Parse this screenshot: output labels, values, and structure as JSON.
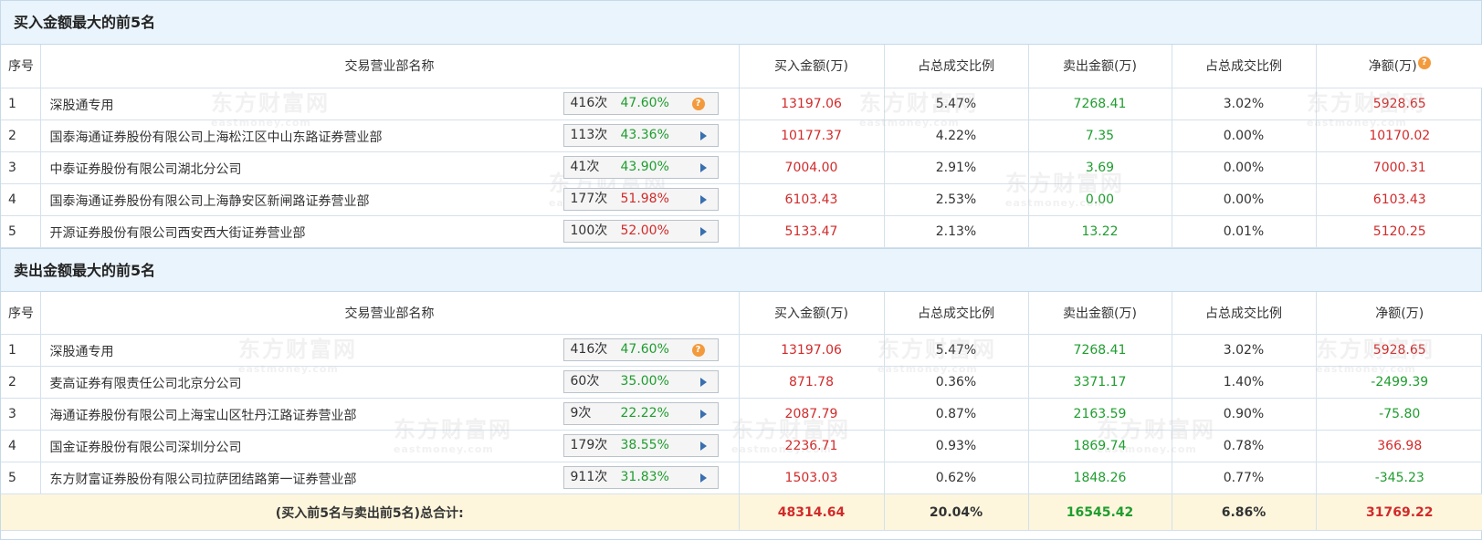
{
  "buy": {
    "title": "买入金额最大的前5名",
    "headers": {
      "seq": "序号",
      "name": "交易营业部名称",
      "buy": "买入金额(万)",
      "buy_ratio": "占总成交比例",
      "sell": "卖出金额(万)",
      "sell_ratio": "占总成交比例",
      "net": "净额(万)"
    },
    "rows": [
      {
        "seq": "1",
        "name": "深股通专用",
        "count": "416次",
        "pct": "47.60%",
        "pct_color": "green",
        "icon": "question-icon",
        "buy": "13197.06",
        "buy_ratio": "5.47%",
        "sell": "7268.41",
        "sell_ratio": "3.02%",
        "net": "5928.65",
        "net_color": "red"
      },
      {
        "seq": "2",
        "name": "国泰海通证券股份有限公司上海松江区中山东路证券营业部",
        "count": "113次",
        "pct": "43.36%",
        "pct_color": "green",
        "icon": "expand-arrow-icon",
        "buy": "10177.37",
        "buy_ratio": "4.22%",
        "sell": "7.35",
        "sell_ratio": "0.00%",
        "net": "10170.02",
        "net_color": "red"
      },
      {
        "seq": "3",
        "name": "中泰证券股份有限公司湖北分公司",
        "count": "41次",
        "pct": "43.90%",
        "pct_color": "green",
        "icon": "expand-arrow-icon",
        "buy": "7004.00",
        "buy_ratio": "2.91%",
        "sell": "3.69",
        "sell_ratio": "0.00%",
        "net": "7000.31",
        "net_color": "red"
      },
      {
        "seq": "4",
        "name": "国泰海通证券股份有限公司上海静安区新闸路证券营业部",
        "count": "177次",
        "pct": "51.98%",
        "pct_color": "red",
        "icon": "expand-arrow-icon",
        "buy": "6103.43",
        "buy_ratio": "2.53%",
        "sell": "0.00",
        "sell_ratio": "0.00%",
        "net": "6103.43",
        "net_color": "red"
      },
      {
        "seq": "5",
        "name": "开源证券股份有限公司西安西大街证券营业部",
        "count": "100次",
        "pct": "52.00%",
        "pct_color": "red",
        "icon": "expand-arrow-icon",
        "buy": "5133.47",
        "buy_ratio": "2.13%",
        "sell": "13.22",
        "sell_ratio": "0.01%",
        "net": "5120.25",
        "net_color": "red"
      }
    ]
  },
  "sell": {
    "title": "卖出金额最大的前5名",
    "headers": {
      "seq": "序号",
      "name": "交易营业部名称",
      "buy": "买入金额(万)",
      "buy_ratio": "占总成交比例",
      "sell": "卖出金额(万)",
      "sell_ratio": "占总成交比例",
      "net": "净额(万)"
    },
    "rows": [
      {
        "seq": "1",
        "name": "深股通专用",
        "count": "416次",
        "pct": "47.60%",
        "pct_color": "green",
        "icon": "question-icon",
        "buy": "13197.06",
        "buy_ratio": "5.47%",
        "sell": "7268.41",
        "sell_ratio": "3.02%",
        "net": "5928.65",
        "net_color": "red"
      },
      {
        "seq": "2",
        "name": "麦高证券有限责任公司北京分公司",
        "count": "60次",
        "pct": "35.00%",
        "pct_color": "green",
        "icon": "expand-arrow-icon",
        "buy": "871.78",
        "buy_ratio": "0.36%",
        "sell": "3371.17",
        "sell_ratio": "1.40%",
        "net": "-2499.39",
        "net_color": "green"
      },
      {
        "seq": "3",
        "name": "海通证券股份有限公司上海宝山区牡丹江路证券营业部",
        "count": "9次",
        "pct": "22.22%",
        "pct_color": "green",
        "icon": "expand-arrow-icon",
        "buy": "2087.79",
        "buy_ratio": "0.87%",
        "sell": "2163.59",
        "sell_ratio": "0.90%",
        "net": "-75.80",
        "net_color": "green"
      },
      {
        "seq": "4",
        "name": "国金证券股份有限公司深圳分公司",
        "count": "179次",
        "pct": "38.55%",
        "pct_color": "green",
        "icon": "expand-arrow-icon",
        "buy": "2236.71",
        "buy_ratio": "0.93%",
        "sell": "1869.74",
        "sell_ratio": "0.78%",
        "net": "366.98",
        "net_color": "red"
      },
      {
        "seq": "5",
        "name": "东方财富证券股份有限公司拉萨团结路第一证券营业部",
        "count": "911次",
        "pct": "31.83%",
        "pct_color": "green",
        "icon": "expand-arrow-icon",
        "buy": "1503.03",
        "buy_ratio": "0.62%",
        "sell": "1848.26",
        "sell_ratio": "0.77%",
        "net": "-345.23",
        "net_color": "green"
      }
    ]
  },
  "total": {
    "label_prefix": "(买入前5名与卖出前5名)",
    "label_bold": "总合计:",
    "buy": "48314.64",
    "buy_ratio": "20.04%",
    "sell": "16545.42",
    "sell_ratio": "6.86%",
    "net": "31769.22"
  },
  "help_icon_glyph": "?",
  "watermark": {
    "cn": "东方财富网",
    "en": "eastmoney.com"
  },
  "colors": {
    "red": "#d12b2b",
    "green": "#1f9d2f",
    "header_bg": "#eaf4fc",
    "total_bg": "#fdf6dd",
    "help_icon": "#f39a3c",
    "arrow_icon": "#3a6fb0"
  }
}
